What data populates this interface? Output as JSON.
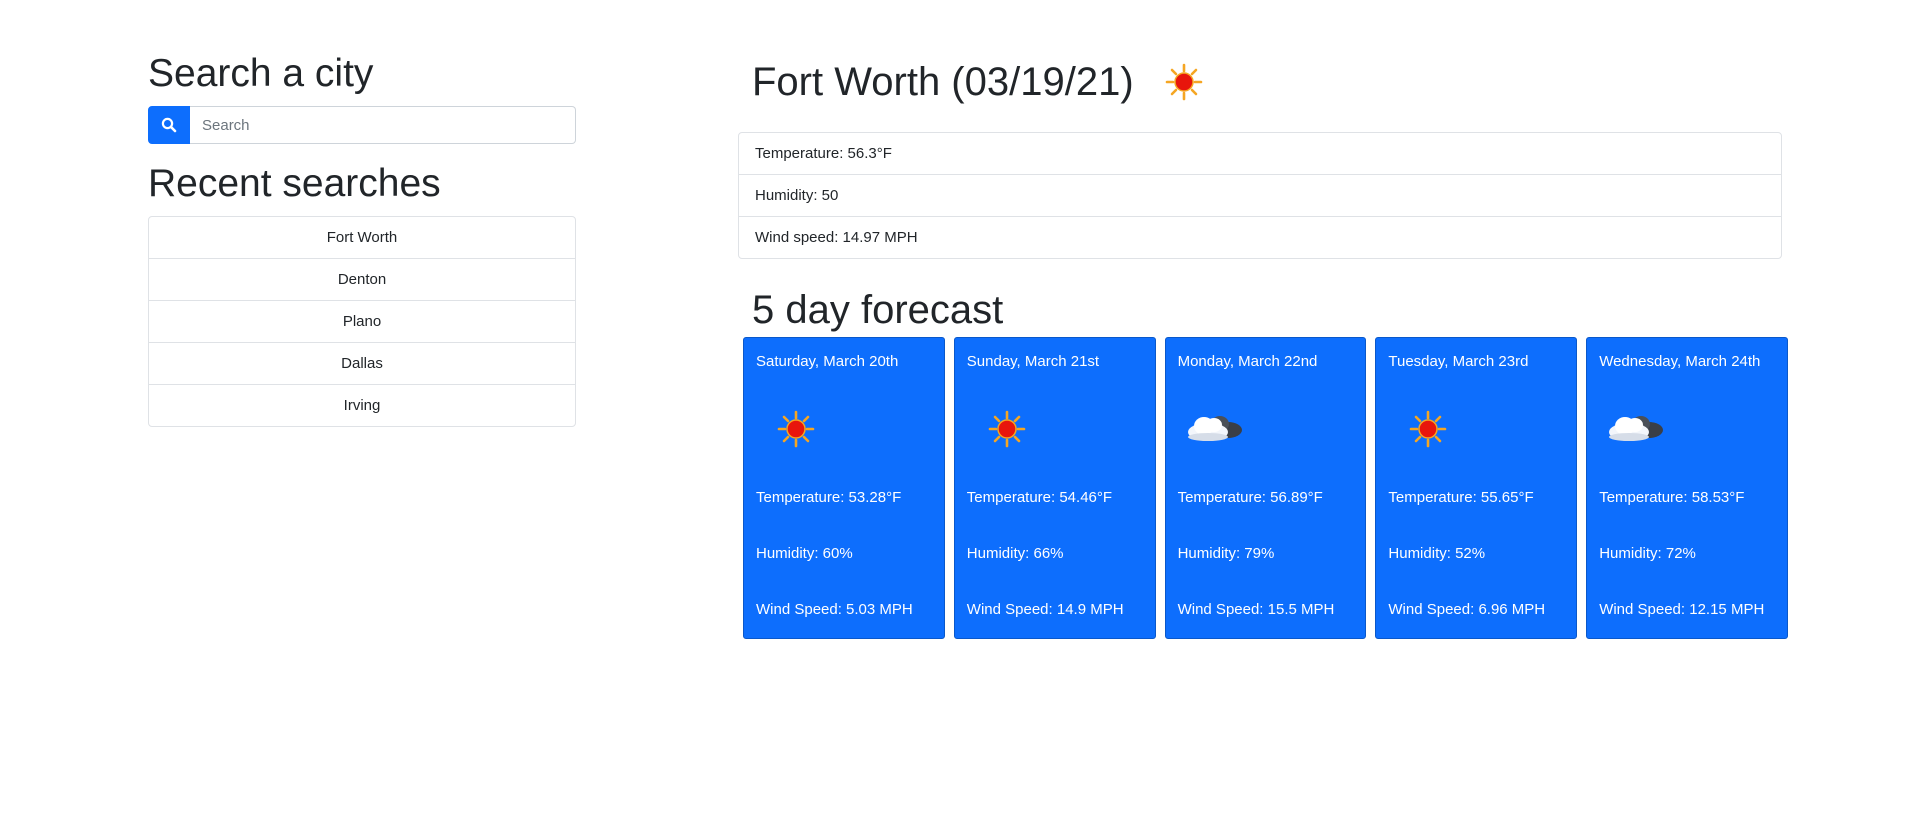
{
  "search": {
    "heading": "Search a city",
    "placeholder": "Search",
    "button_icon": "search-icon"
  },
  "recent": {
    "heading": "Recent searches",
    "items": [
      {
        "label": "Fort Worth"
      },
      {
        "label": "Denton"
      },
      {
        "label": "Plano"
      },
      {
        "label": "Dallas"
      },
      {
        "label": "Irving"
      }
    ]
  },
  "current": {
    "title": "Fort Worth (03/19/21)",
    "icon": "sun-icon",
    "temperature": "Temperature: 56.3°F",
    "humidity": "Humidity: 50",
    "wind": "Wind speed: 14.97 MPH"
  },
  "forecast": {
    "heading": "5 day forecast",
    "days": [
      {
        "date": "Saturday, March 20th",
        "icon": "sun-icon",
        "temp": "Temperature: 53.28°F",
        "humidity": "Humidity: 60%",
        "wind": "Wind Speed: 5.03 MPH"
      },
      {
        "date": "Sunday, March 21st",
        "icon": "sun-icon",
        "temp": "Temperature: 54.46°F",
        "humidity": "Humidity: 66%",
        "wind": "Wind Speed: 14.9 MPH"
      },
      {
        "date": "Monday, March 22nd",
        "icon": "cloud-icon",
        "temp": "Temperature: 56.89°F",
        "humidity": "Humidity: 79%",
        "wind": "Wind Speed: 15.5 MPH"
      },
      {
        "date": "Tuesday, March 23rd",
        "icon": "sun-icon",
        "temp": "Temperature: 55.65°F",
        "humidity": "Humidity: 52%",
        "wind": "Wind Speed: 6.96 MPH"
      },
      {
        "date": "Wednesday, March 24th",
        "icon": "cloud-icon",
        "temp": "Temperature: 58.53°F",
        "humidity": "Humidity: 72%",
        "wind": "Wind Speed: 12.15 MPH"
      }
    ]
  },
  "colors": {
    "primary": "#0d6efd",
    "text": "#212529",
    "border": "#dfe2e6"
  }
}
